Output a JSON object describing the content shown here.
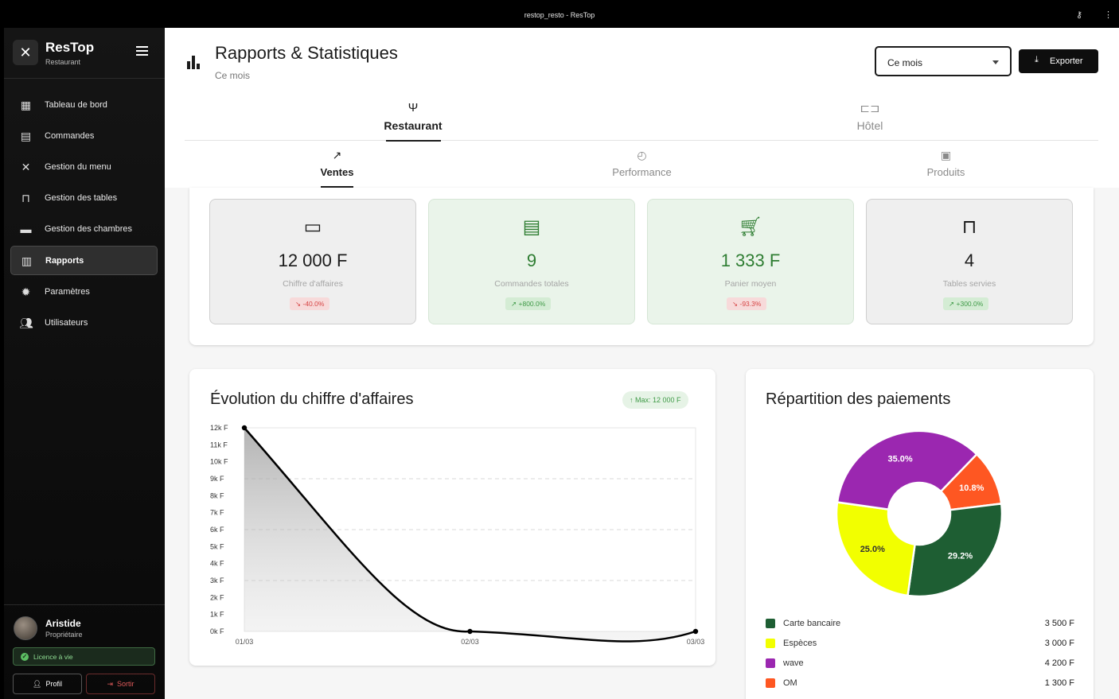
{
  "window": {
    "title": "restop_resto - ResTop"
  },
  "sidebar": {
    "brand": "ResTop",
    "brand_sub": "Restaurant",
    "items": [
      {
        "label": "Tableau de bord",
        "icon": "dashboard-icon"
      },
      {
        "label": "Commandes",
        "icon": "receipt-icon"
      },
      {
        "label": "Gestion du menu",
        "icon": "utensils-icon"
      },
      {
        "label": "Gestion des tables",
        "icon": "table-icon"
      },
      {
        "label": "Gestion des chambres",
        "icon": "bed-icon"
      },
      {
        "label": "Rapports",
        "icon": "chart-icon",
        "active": true
      },
      {
        "label": "Paramètres",
        "icon": "gear-icon"
      },
      {
        "label": "Utilisateurs",
        "icon": "users-icon"
      }
    ],
    "user": {
      "name": "Aristide",
      "role": "Propriétaire"
    },
    "license": "Licence à vie",
    "profile_label": "Profil",
    "logout_label": "Sortir"
  },
  "header": {
    "title": "Rapports & Statistiques",
    "subtitle": "Ce mois",
    "period_select": "Ce mois",
    "export_label": "Exporter"
  },
  "tabs_primary": [
    {
      "label": "Restaurant",
      "active": true
    },
    {
      "label": "Hôtel",
      "active": false
    }
  ],
  "tabs_secondary": [
    {
      "label": "Ventes",
      "active": true
    },
    {
      "label": "Performance",
      "active": false
    },
    {
      "label": "Produits",
      "active": false
    }
  ],
  "kpis": [
    {
      "value": "12 000 F",
      "label": "Chiffre d'affaires",
      "trend": "-40.0%",
      "direction": "down",
      "tint": "#efefef",
      "value_color": "#1b1b1b",
      "icon_color": "#1b1b1b"
    },
    {
      "value": "9",
      "label": "Commandes totales",
      "trend": "+800.0%",
      "direction": "up",
      "tint": "#eaf4ea",
      "value_color": "#2e7d32",
      "icon_color": "#2e7d32"
    },
    {
      "value": "1 333 F",
      "label": "Panier moyen",
      "trend": "-93.3%",
      "direction": "down",
      "tint": "#eaf4ea",
      "value_color": "#2e7d32",
      "icon_color": "#2e7d32"
    },
    {
      "value": "4",
      "label": "Tables servies",
      "trend": "+300.0%",
      "direction": "up",
      "tint": "#efefef",
      "value_color": "#1b1b1b",
      "icon_color": "#1b1b1b"
    }
  ],
  "revenue_chart": {
    "title": "Évolution du chiffre d'affaires",
    "max_badge": "Max: 12 000 F"
  },
  "payments_chart": {
    "title": "Répartition des paiements"
  },
  "chart_data": [
    {
      "type": "area",
      "title": "Évolution du chiffre d'affaires",
      "x": [
        "01/03",
        "02/03",
        "03/03"
      ],
      "values": [
        12000,
        0,
        0
      ],
      "ylim": [
        0,
        12000
      ],
      "y_ticks": [
        "0k F",
        "1k F",
        "2k F",
        "3k F",
        "4k F",
        "5k F",
        "6k F",
        "7k F",
        "8k F",
        "9k F",
        "10k F",
        "11k F",
        "12k F"
      ],
      "grid": true
    },
    {
      "type": "pie",
      "title": "Répartition des paiements",
      "slices": [
        {
          "name": "Carte bancaire",
          "value": 3500,
          "amount": "3 500 F",
          "percent": "29.2%",
          "color": "#1e5e33"
        },
        {
          "name": "Espèces",
          "value": 3000,
          "amount": "3 000 F",
          "percent": "25.0%",
          "color": "#f2ff00"
        },
        {
          "name": "wave",
          "value": 4200,
          "amount": "4 200 F",
          "percent": "35.0%",
          "color": "#9b27b0"
        },
        {
          "name": "OM",
          "value": 1300,
          "amount": "1 300 F",
          "percent": "10.8%",
          "color": "#fe5722"
        }
      ]
    }
  ]
}
